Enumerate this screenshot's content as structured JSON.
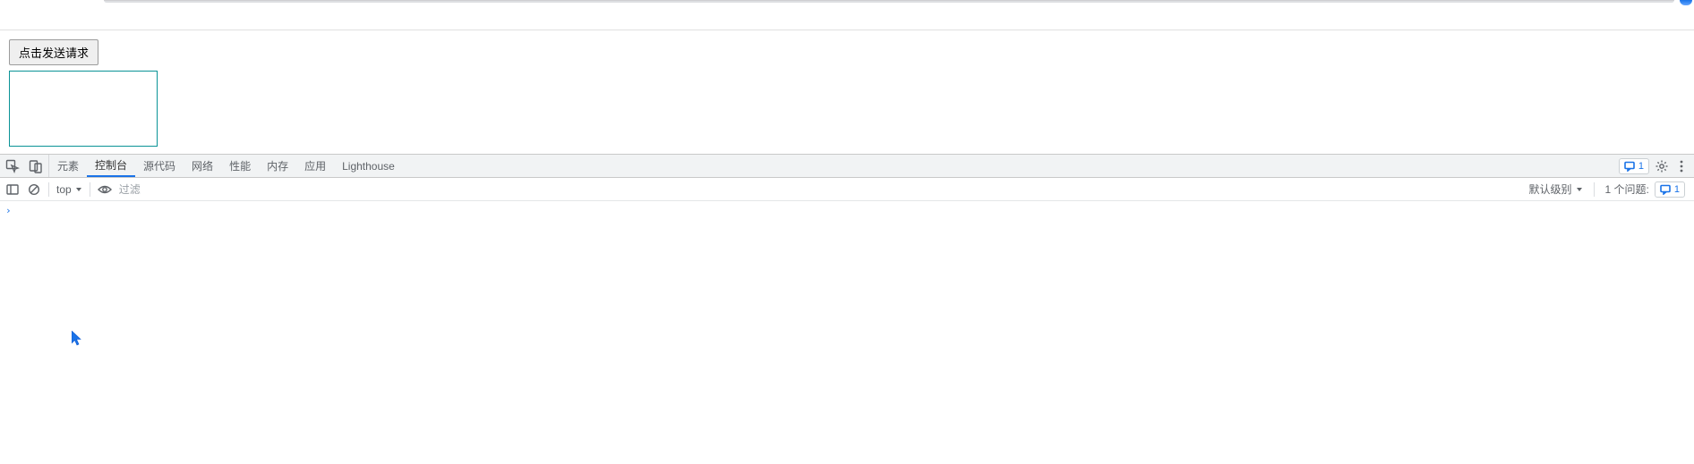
{
  "page": {
    "send_button_label": "点击发送请求"
  },
  "devtools": {
    "tabs": {
      "elements": "元素",
      "console": "控制台",
      "sources": "源代码",
      "network": "网络",
      "performance": "性能",
      "memory": "内存",
      "application": "应用",
      "lighthouse": "Lighthouse"
    },
    "issues_badge": "1"
  },
  "console_toolbar": {
    "context": "top",
    "filter_placeholder": "过滤",
    "level_label": "默认级别",
    "issues_label": "1 个问题:",
    "issues_count": "1"
  }
}
